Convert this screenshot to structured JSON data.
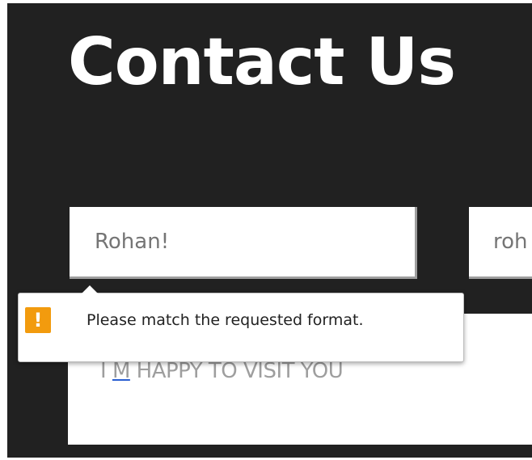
{
  "page": {
    "title": "Contact Us"
  },
  "form": {
    "name_value": "Rohan!",
    "email_value_visible": "roh",
    "message_prefix": "I ",
    "message_underlined": "M",
    "message_suffix": " HAPPY TO VISIT YOU"
  },
  "validation_tooltip": {
    "icon": "warning-icon",
    "icon_glyph": "!",
    "message": "Please match the requested format."
  },
  "colors": {
    "background": "#212121",
    "title": "#ffffff",
    "warning": "#f29b0e"
  }
}
